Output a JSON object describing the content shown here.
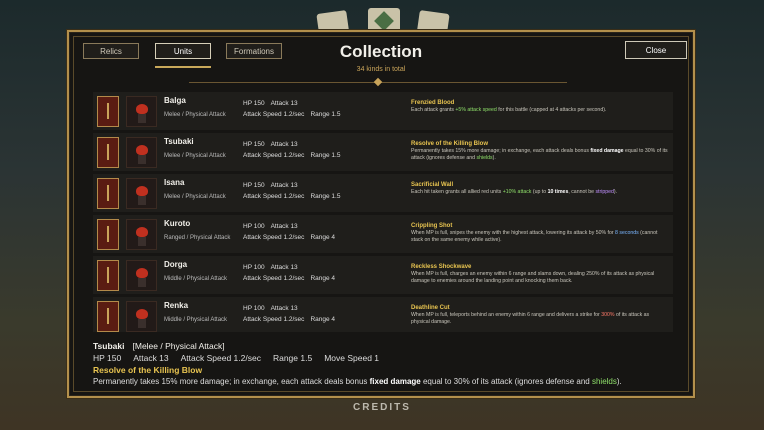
{
  "tabs": [
    "Relics",
    "Units",
    "Formations"
  ],
  "active_tab": "Units",
  "title": "Collection",
  "subtitle": "34 kinds in total",
  "close_label": "Close",
  "footer": "CREDITS",
  "units": [
    {
      "name": "Balga",
      "type": "Melee / Physical Attack",
      "hp": "HP 150",
      "attack": "Attack 13",
      "speed": "Attack Speed 1.2/sec",
      "range": "Range 1.5",
      "skill": "Frenzied Blood",
      "desc_parts": [
        {
          "t": "Each attack grants ",
          "c": ""
        },
        {
          "t": "+5% attack speed",
          "c": "green"
        },
        {
          "t": " for this battle (capped at 4 attacks per second).",
          "c": ""
        }
      ]
    },
    {
      "name": "Tsubaki",
      "type": "Melee / Physical Attack",
      "hp": "HP 150",
      "attack": "Attack 13",
      "speed": "Attack Speed 1.2/sec",
      "range": "Range 1.5",
      "skill": "Resolve of the Killing Blow",
      "desc_parts": [
        {
          "t": "Permanently takes 15% more damage; in exchange, each attack deals bonus ",
          "c": ""
        },
        {
          "t": "fixed damage",
          "c": "white"
        },
        {
          "t": " equal to 30% of its attack (ignores defense and ",
          "c": ""
        },
        {
          "t": "shields",
          "c": "green"
        },
        {
          "t": ").",
          "c": ""
        }
      ]
    },
    {
      "name": "Isana",
      "type": "Melee / Physical Attack",
      "hp": "HP 150",
      "attack": "Attack 13",
      "speed": "Attack Speed 1.2/sec",
      "range": "Range 1.5",
      "skill": "Sacrificial Wall",
      "desc_parts": [
        {
          "t": "Each hit taken grants all allied red units ",
          "c": ""
        },
        {
          "t": "+10% attack",
          "c": "green"
        },
        {
          "t": " (up to ",
          "c": ""
        },
        {
          "t": "10 times",
          "c": "white"
        },
        {
          "t": ", cannot be ",
          "c": ""
        },
        {
          "t": "stripped",
          "c": "purple"
        },
        {
          "t": ").",
          "c": ""
        }
      ]
    },
    {
      "name": "Kuroto",
      "type": "Ranged / Physical Attack",
      "hp": "HP 100",
      "attack": "Attack 13",
      "speed": "Attack Speed 1.2/sec",
      "range": "Range 4",
      "skill": "Crippling Shot",
      "desc_parts": [
        {
          "t": "When MP is full, snipes the enemy with the highest attack, lowering its attack by 50% for ",
          "c": ""
        },
        {
          "t": "8 seconds",
          "c": "blue"
        },
        {
          "t": " (cannot stack on the same enemy while active).",
          "c": ""
        }
      ]
    },
    {
      "name": "Dorga",
      "type": "Middle / Physical Attack",
      "hp": "HP 100",
      "attack": "Attack 13",
      "speed": "Attack Speed 1.2/sec",
      "range": "Range 4",
      "skill": "Reckless Shockwave",
      "desc_parts": [
        {
          "t": "When MP is full, charges an enemy within 6 range and slams down, dealing 250% of its attack as physical damage to enemies around the landing point and knocking them back.",
          "c": ""
        }
      ]
    },
    {
      "name": "Renka",
      "type": "Middle / Physical Attack",
      "hp": "HP 100",
      "attack": "Attack 13",
      "speed": "Attack Speed 1.2/sec",
      "range": "Range 4",
      "skill": "Deathline Cut",
      "desc_parts": [
        {
          "t": "When MP is full, teleports behind an enemy within 6 range and delivers a strike for ",
          "c": ""
        },
        {
          "t": "300%",
          "c": "red"
        },
        {
          "t": " of its attack as physical damage.",
          "c": ""
        }
      ]
    }
  ],
  "detail": {
    "name": "Tsubaki",
    "type": "[Melee / Physical Attack]",
    "hp": "HP 150",
    "attack": "Attack 13",
    "speed": "Attack Speed 1.2/sec",
    "range": "Range 1.5",
    "move": "Move Speed 1",
    "skill": "Resolve of the Killing Blow",
    "desc_parts": [
      {
        "t": "Permanently takes 15% more damage; in exchange, each attack deals bonus ",
        "c": ""
      },
      {
        "t": "fixed damage",
        "c": "white"
      },
      {
        "t": " equal to 30% of its attack (ignores defense and ",
        "c": ""
      },
      {
        "t": "shields",
        "c": "green"
      },
      {
        "t": ").",
        "c": ""
      }
    ]
  },
  "colors": {
    "gold_border": "#b3904c",
    "skill_name": "#e8c450",
    "highlight_green": "#8fe06a",
    "highlight_blue": "#7ab6ff",
    "highlight_purple": "#c090ff",
    "highlight_red": "#ff7a6a"
  }
}
